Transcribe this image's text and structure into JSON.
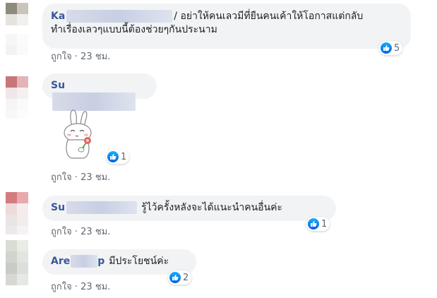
{
  "comments": [
    {
      "author": "Ka",
      "text": "อย่าให้คนเลวมีที่ยืนคนเค้าให้โอกาสแต่กลับทำเรื่องเลวๆแบบนี้ต้องช่วยๆกันประนาม",
      "line1_prefix": "/ อย่าให้คนเลวมีที่ยืนคนเค้าให้โอกาสแต่กลับ",
      "line2": "ทำเรื่องเลวๆแบบนี้ต้องช่วยๆกันประนาม",
      "reactions": "5",
      "like_label": "ถูกใจ",
      "time": "23 ชม."
    },
    {
      "author": "Su",
      "reactions": "1",
      "like_label": "ถูกใจ",
      "time": "23 ชม."
    },
    {
      "author": "Su",
      "text": "รู้ไว้ครั้งหลังจะได้แนะนำคนอื่นค่ะ",
      "reactions": "1",
      "like_label": "ถูกใจ",
      "time": "23 ชม."
    },
    {
      "author": "Are",
      "author_tail": "p",
      "text": "มีประโยชน์ค่ะ",
      "reactions": "2",
      "like_label": "ถูกใจ",
      "time": "23 ชม."
    }
  ],
  "separator": "·",
  "colors": {
    "bubble": "#f2f3f5",
    "author": "#385898",
    "meta": "#606770",
    "like_blue": "#1877f2"
  },
  "icons": {
    "reaction": "thumbs-up-icon",
    "sticker": "bunny-flower-sticker"
  }
}
